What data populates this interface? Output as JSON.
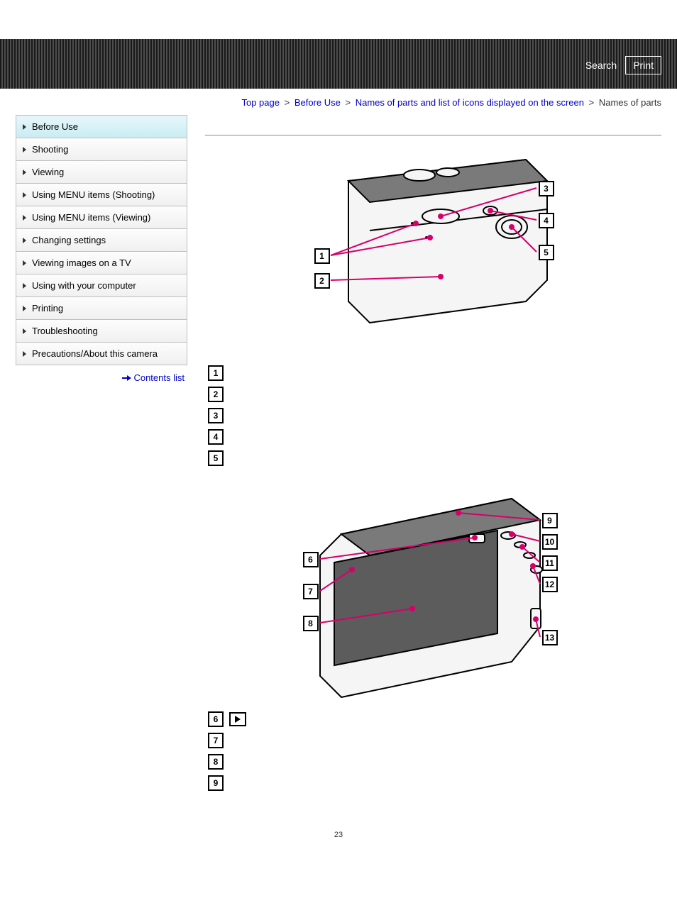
{
  "topbar": {
    "search": "Search",
    "print": "Print"
  },
  "breadcrumb": {
    "top": "Top page",
    "before_use": "Before Use",
    "list_icons": "Names of parts and list of icons displayed on the screen",
    "current": "Names of parts"
  },
  "sidebar": {
    "items": [
      "Before Use",
      "Shooting",
      "Viewing",
      "Using MENU items (Shooting)",
      "Using MENU items (Viewing)",
      "Changing settings",
      "Viewing images on a TV",
      "Using with your computer",
      "Printing",
      "Troubleshooting",
      "Precautions/About this camera"
    ],
    "contents_list": "Contents list"
  },
  "diagram1": {
    "callouts_left": [
      "1",
      "2"
    ],
    "callouts_right": [
      "3",
      "4",
      "5"
    ]
  },
  "legend1": [
    "1",
    "2",
    "3",
    "4",
    "5"
  ],
  "diagram2": {
    "callouts_left": [
      "6",
      "7",
      "8"
    ],
    "callouts_right": [
      "9",
      "10",
      "11",
      "12",
      "13"
    ]
  },
  "legend2": [
    "6",
    "7",
    "8",
    "9"
  ],
  "page_number": "23"
}
